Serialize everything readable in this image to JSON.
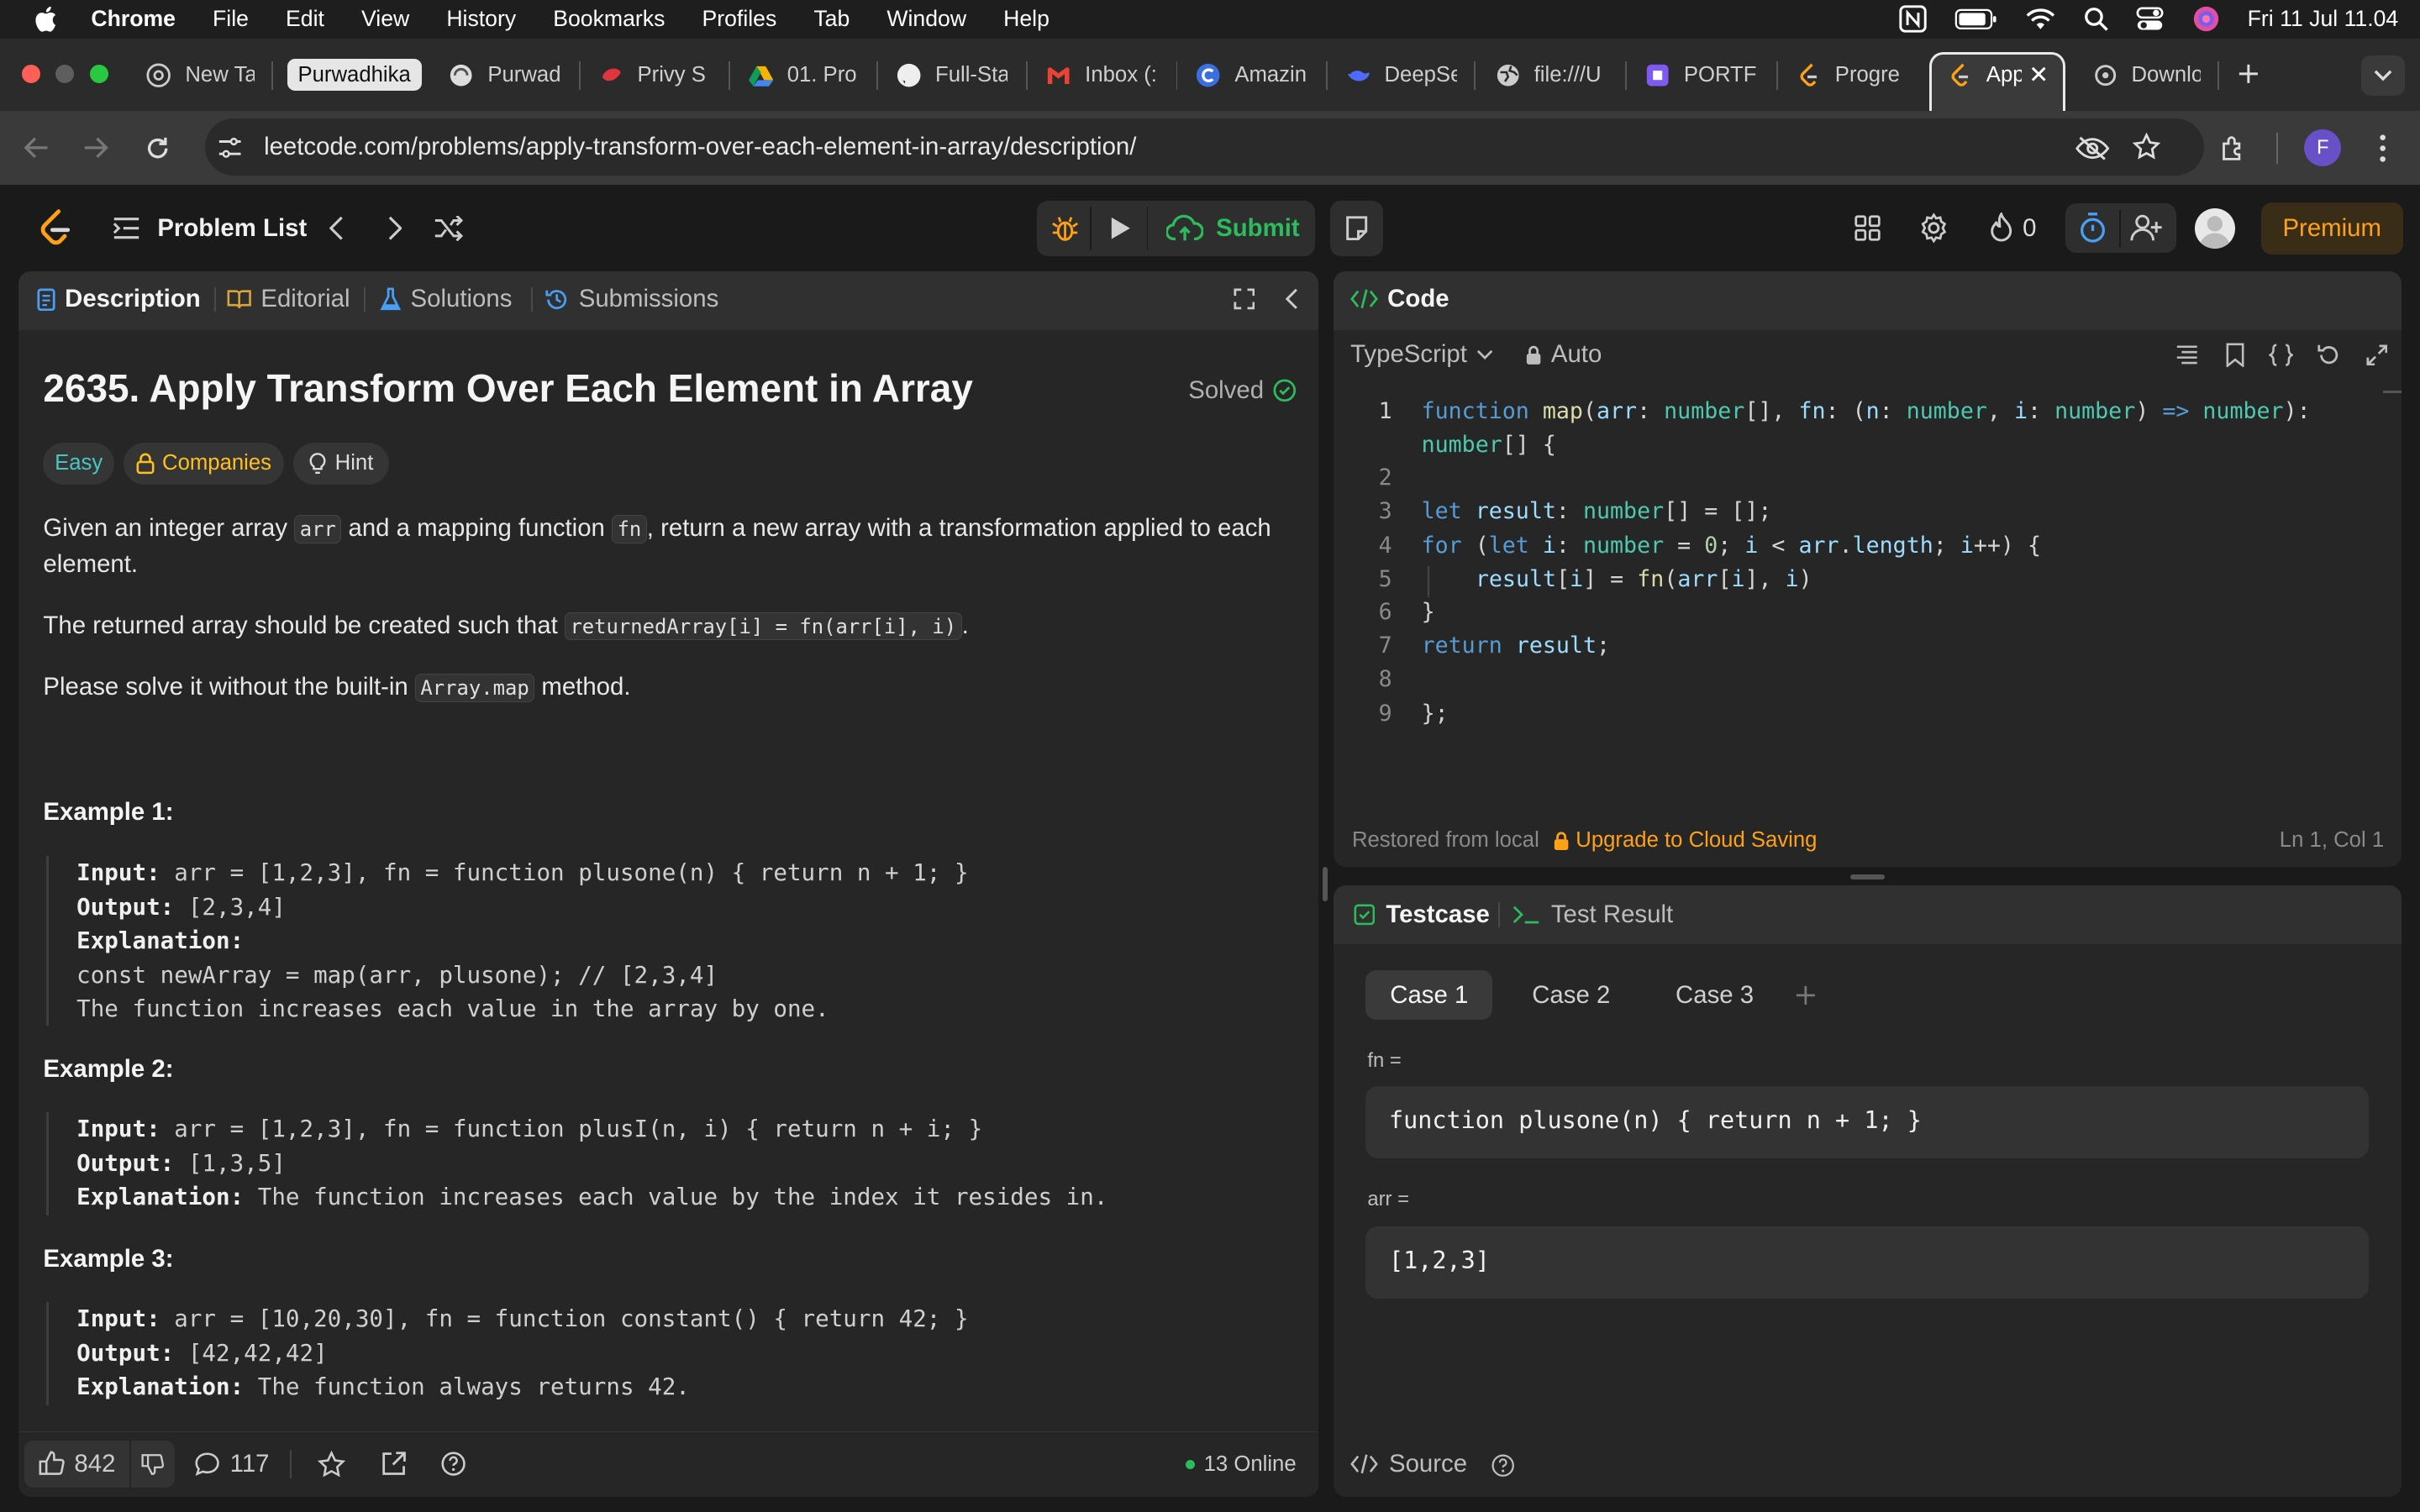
{
  "menubar": {
    "app": "Chrome",
    "items": [
      "File",
      "Edit",
      "View",
      "History",
      "Bookmarks",
      "Profiles",
      "Tab",
      "Window",
      "Help"
    ],
    "clock": "Fri 11 Jul  11.04"
  },
  "tabs": [
    {
      "label": "New Ta"
    },
    {
      "label": "Purwadhika"
    },
    {
      "label": "Purwad"
    },
    {
      "label": "Privy Sl"
    },
    {
      "label": "01. Pro"
    },
    {
      "label": "Full-Sta"
    },
    {
      "label": "Inbox (:"
    },
    {
      "label": "Amazin"
    },
    {
      "label": "DeepSe"
    },
    {
      "label": "file:///U"
    },
    {
      "label": "PORTF("
    },
    {
      "label": "Progre"
    },
    {
      "label": "App"
    },
    {
      "label": "Downlo"
    }
  ],
  "address": {
    "url": "leetcode.com/problems/apply-transform-over-each-element-in-array/description/",
    "profile_initial": "F"
  },
  "lc_header": {
    "problem_list": "Problem List",
    "submit": "Submit",
    "streak": "0",
    "premium": "Premium"
  },
  "desc_panel": {
    "tabs": [
      "Description",
      "Editorial",
      "Solutions",
      "Submissions"
    ],
    "title": "2635. Apply Transform Over Each Element in Array",
    "status": "Solved",
    "tags": {
      "difficulty": "Easy",
      "companies": "Companies",
      "hint": "Hint"
    },
    "p1": {
      "a": "Given an integer array ",
      "code1": "arr",
      "b": " and a mapping function ",
      "code2": "fn",
      "c": ", return a new array with a transformation applied to each",
      "d": "element."
    },
    "p2": {
      "a": "The returned array should be created such that ",
      "code": "returnedArray[i] = fn(arr[i], i)",
      "b": "."
    },
    "p3": {
      "a": "Please solve it without the built-in ",
      "code": "Array.map",
      "b": " method."
    },
    "examples": [
      {
        "title": "Example 1:",
        "input_label": "Input:",
        "input": " arr = [1,2,3], fn = function plusone(n) { return n + 1; }",
        "output_label": "Output:",
        "output": " [2,3,4]",
        "explanation_label": "Explanation:",
        "explanation": "",
        "extra1": "const newArray = map(arr, plusone); // [2,3,4]",
        "extra2": "The function increases each value in the array by one."
      },
      {
        "title": "Example 2:",
        "input_label": "Input:",
        "input": " arr = [1,2,3], fn = function plusI(n, i) { return n + i; }",
        "output_label": "Output:",
        "output": " [1,3,5]",
        "explanation_label": "Explanation:",
        "explanation": " The function increases each value by the index it resides in."
      },
      {
        "title": "Example 3:",
        "input_label": "Input:",
        "input": " arr = [10,20,30], fn = function constant() { return 42; }",
        "output_label": "Output:",
        "output": " [42,42,42]",
        "explanation_label": "Explanation:",
        "explanation": " The function always returns 42."
      }
    ],
    "footer": {
      "likes": "842",
      "comments": "117",
      "online": "13 Online"
    }
  },
  "code_panel": {
    "title": "Code",
    "language": "TypeScript",
    "mode": "Auto",
    "line_numbers": [
      "1",
      "2",
      "3",
      "4",
      "5",
      "6",
      "7",
      "8",
      "9"
    ],
    "status_left": "Restored from local",
    "status_upgrade": "Upgrade to Cloud Saving",
    "cursor": "Ln 1, Col 1"
  },
  "test_panel": {
    "tab_testcase": "Testcase",
    "tab_result": "Test Result",
    "cases": [
      "Case 1",
      "Case 2",
      "Case 3"
    ],
    "fn_label": "fn =",
    "fn_value": "function plusone(n) { return n + 1; }",
    "arr_label": "arr =",
    "arr_value": "[1,2,3]",
    "source": "Source"
  },
  "colors": {
    "accent_green": "#2cbb5d",
    "easy": "#46c6c2",
    "companies": "#ffc01e",
    "premium": "#ffa116"
  }
}
